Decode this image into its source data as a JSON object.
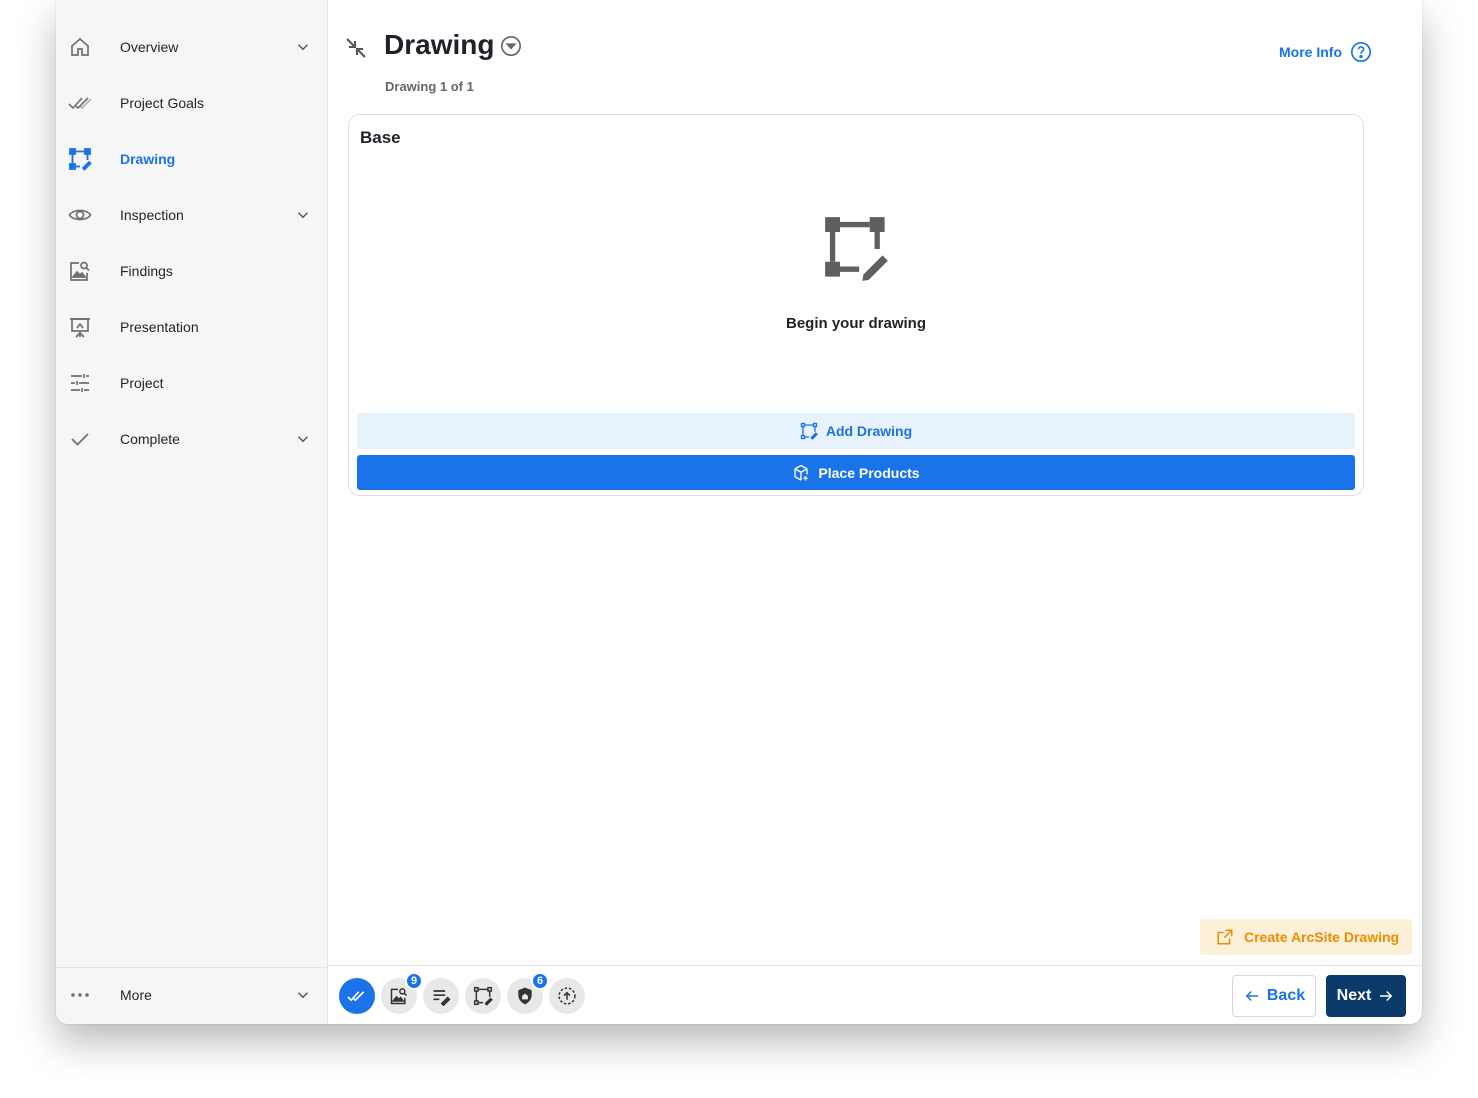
{
  "sidebar": {
    "items": [
      {
        "label": "Overview",
        "icon": "home-icon",
        "has_chevron": true
      },
      {
        "label": "Project Goals",
        "icon": "double-check-icon",
        "has_chevron": false
      },
      {
        "label": "Drawing",
        "icon": "drawing-icon",
        "has_chevron": false,
        "active": true
      },
      {
        "label": "Inspection",
        "icon": "eye-icon",
        "has_chevron": true
      },
      {
        "label": "Findings",
        "icon": "image-search-icon",
        "has_chevron": false
      },
      {
        "label": "Presentation",
        "icon": "presentation-icon",
        "has_chevron": false
      },
      {
        "label": "Project",
        "icon": "sliders-icon",
        "has_chevron": false
      },
      {
        "label": "Complete",
        "icon": "check-icon",
        "has_chevron": true
      }
    ],
    "more_label": "More"
  },
  "header": {
    "title": "Drawing",
    "subtitle": "Drawing 1 of 1",
    "more_info": "More Info"
  },
  "card": {
    "title": "Base",
    "empty_text": "Begin your drawing",
    "add_drawing": "Add Drawing",
    "place_products": "Place Products"
  },
  "arcsite": {
    "label": "Create ArcSite Drawing"
  },
  "toolbar": {
    "tools": [
      {
        "icon": "double-check-icon",
        "badge": ""
      },
      {
        "icon": "image-search-icon",
        "badge": "9"
      },
      {
        "icon": "notes-edit-icon",
        "badge": ""
      },
      {
        "icon": "drawing-icon",
        "badge": ""
      },
      {
        "icon": "shield-home-icon",
        "badge": "6"
      },
      {
        "icon": "sync-upload-icon",
        "badge": ""
      }
    ],
    "back": "Back",
    "next": "Next"
  },
  "colors": {
    "accent": "#1a73e8",
    "primary_dark": "#0b3a6b",
    "warning": "#f08c00",
    "warning_bg": "#fdf0d8"
  }
}
